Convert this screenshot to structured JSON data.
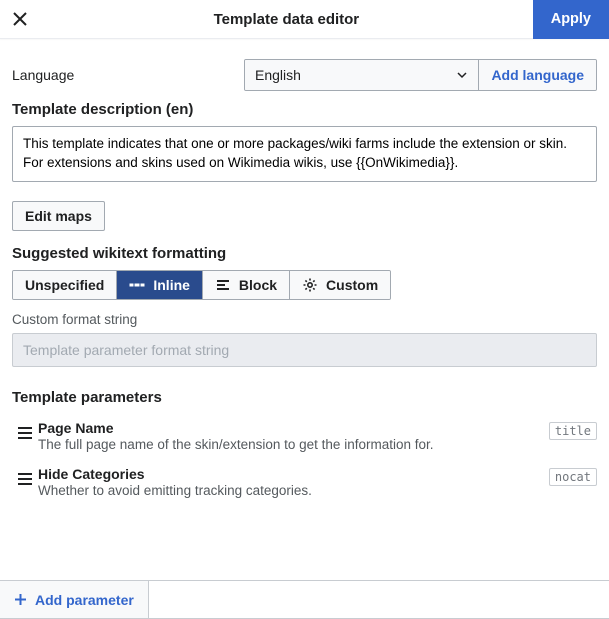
{
  "header": {
    "title": "Template data editor",
    "apply": "Apply"
  },
  "language": {
    "label": "Language",
    "selected": "English",
    "add": "Add language"
  },
  "description": {
    "heading": "Template description (en)",
    "value": "This template indicates that one or more packages/wiki farms include the extension or skin. For extensions and skins used on Wikimedia wikis, use {{OnWikimedia}}."
  },
  "edit_maps": "Edit maps",
  "formatting": {
    "heading": "Suggested wikitext formatting",
    "options": {
      "unspecified": "Unspecified",
      "inline": "Inline",
      "block": "Block",
      "custom": "Custom"
    },
    "custom_label": "Custom format string",
    "custom_placeholder": "Template parameter format string"
  },
  "parameters": {
    "heading": "Template parameters",
    "items": [
      {
        "name": "Page Name",
        "desc": "The full page name of the skin/extension to get the information for.",
        "key": "title"
      },
      {
        "name": "Hide Categories",
        "desc": "Whether to avoid emitting tracking categories.",
        "key": "nocat"
      }
    ]
  },
  "footer": {
    "add_parameter": "Add parameter"
  }
}
